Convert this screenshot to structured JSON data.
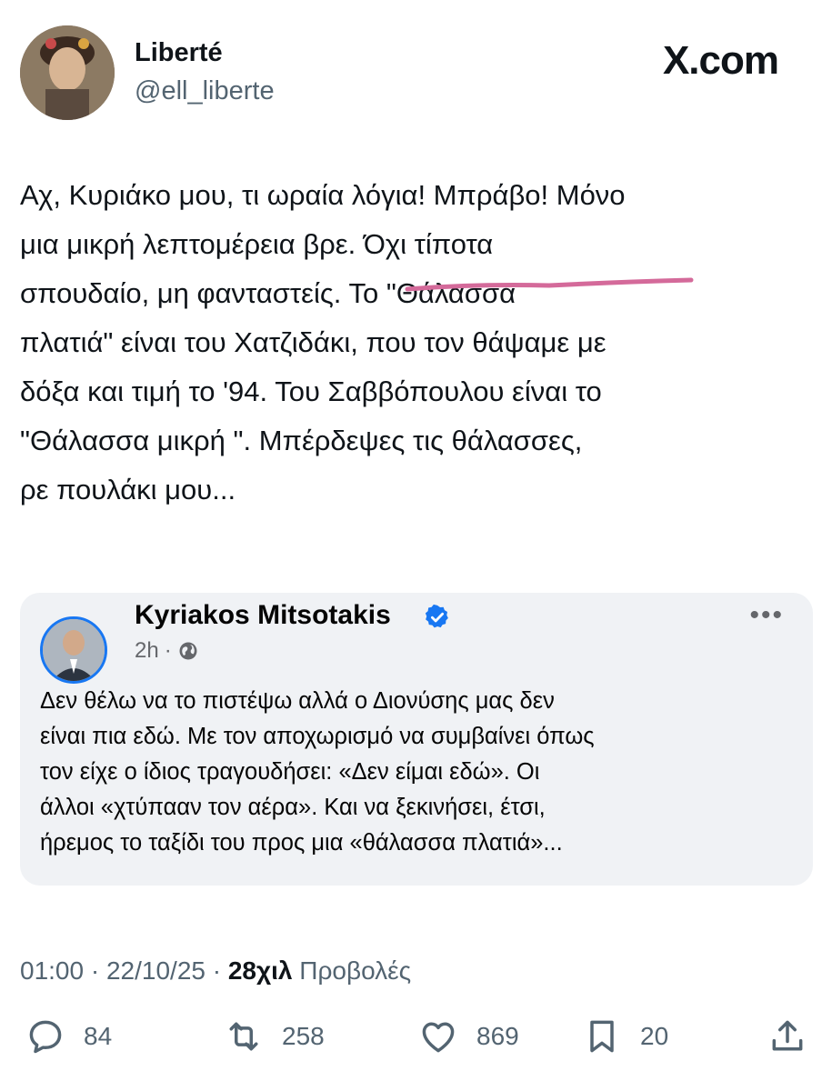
{
  "header": {
    "display_name": "Liberté",
    "handle": "@ell_liberte",
    "brand": "X.com",
    "avatar_icon": "profile-photo-avatar"
  },
  "tweet": {
    "text": "Αχ, Κυριάκο μου, τι ωραία λόγια! Μπράβο! Μόνο\nμια μικρή λεπτομέρεια βρε. Όχι τίποτα\nσπουδαίο, μη φανταστείς. Το \"Θάλασσα\nπλατιά\" είναι του Χατζιδάκι, που τον θάψαμε με\nδόξα και τιμή το '94. Του Σαββόπουλου είναι το\n\"Θάλασσα μικρή \". Μπέρδεψες τις θάλασσες,\nρε πουλάκι μου..."
  },
  "embedded_post": {
    "author": "Kyriakos Mitsotakis",
    "time": "2h",
    "separator": "·",
    "audience_icon": "globe-icon",
    "verified_icon": "verified-badge-icon",
    "more_label": "•••",
    "text": "Δεν θέλω να το πιστέψω αλλά ο Διονύσης μας δεν\nείναι πια εδώ. Με τον αποχωρισμό να συμβαίνει όπως\nτον είχε ο ίδιος τραγουδήσει: «Δεν είμαι εδώ». Οι\nάλλοι «χτύπααν τον αέρα». Και να ξεκινήσει, έτσι,\nήρεμος το ταξίδι του προς μια «θάλασσα πλατιά»...",
    "underline_color": "#d46a9a"
  },
  "meta": {
    "time": "01:00",
    "dot1": " · ",
    "date": "22/10/25",
    "dot2": " · ",
    "views_count": "28χιλ",
    "views_label": "Προβολές"
  },
  "actions": {
    "replies": "84",
    "reposts": "258",
    "likes": "869",
    "bookmarks": "20"
  },
  "colors": {
    "text": "#0f1419",
    "secondary": "#536471",
    "card_bg": "#f0f2f5",
    "verified": "#1877f2"
  }
}
